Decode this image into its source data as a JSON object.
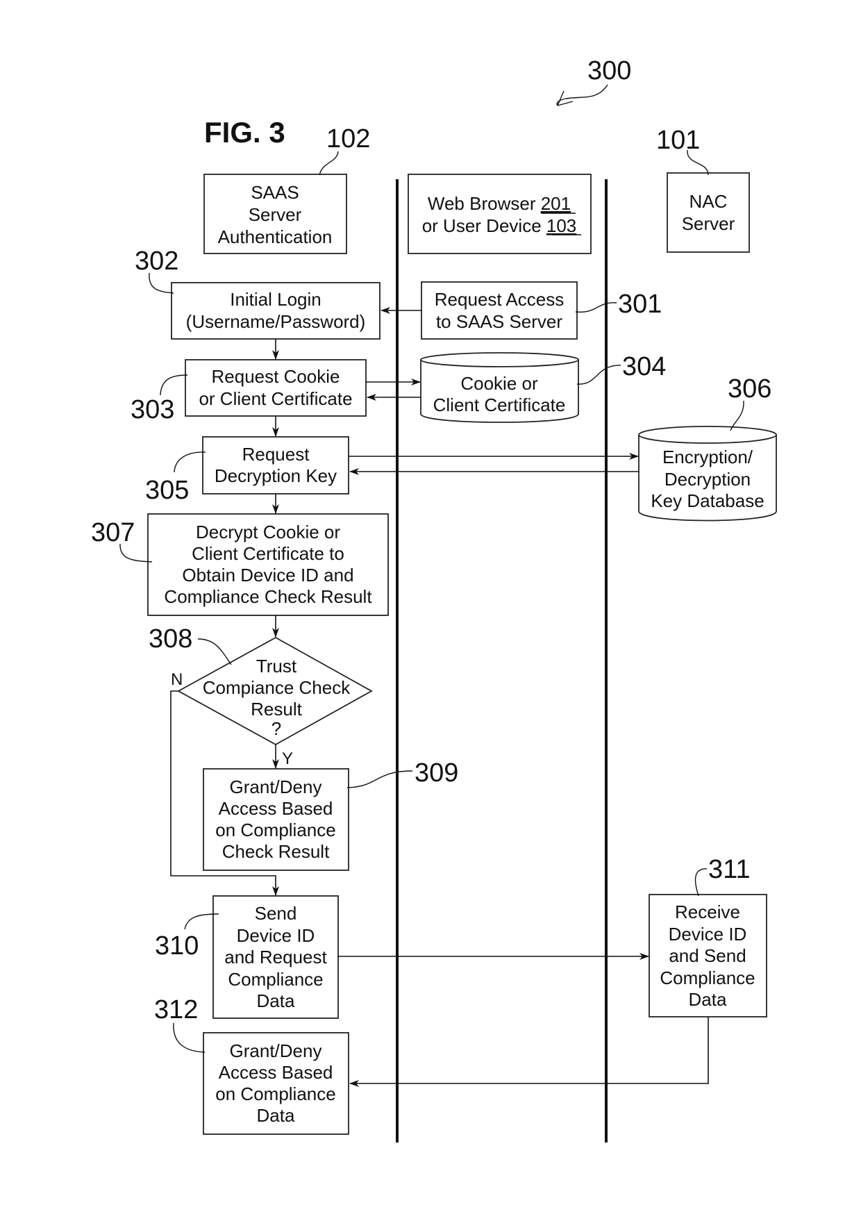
{
  "figure": {
    "title": "FIG. 3",
    "number": "300"
  },
  "actors": {
    "saas": {
      "ref": "102",
      "lines": [
        "SAAS",
        "Server",
        "Authentication"
      ]
    },
    "browser": {
      "lines": [
        "Web Browser ",
        "or User Device "
      ],
      "refs": [
        "201",
        "103"
      ]
    },
    "nac": {
      "ref": "101",
      "lines": [
        "NAC",
        "Server"
      ]
    }
  },
  "steps": {
    "s301": {
      "ref": "301",
      "lines": [
        "Request Access",
        "to SAAS Server"
      ]
    },
    "s302": {
      "ref": "302",
      "lines": [
        "Initial Login",
        "(Username/Password)"
      ]
    },
    "s303": {
      "ref": "303",
      "lines": [
        "Request Cookie",
        "or Client Certificate"
      ]
    },
    "s304": {
      "ref": "304",
      "lines": [
        "Cookie or",
        "Client Certificate"
      ]
    },
    "s305": {
      "ref": "305",
      "lines": [
        "Request",
        "Decryption Key"
      ]
    },
    "s306": {
      "ref": "306",
      "lines": [
        "Encryption/",
        "Decryption",
        "Key Database"
      ]
    },
    "s307": {
      "ref": "307",
      "lines": [
        "Decrypt Cookie or",
        "Client Certificate to",
        "Obtain Device ID and",
        "Compliance Check Result"
      ]
    },
    "s308": {
      "ref": "308",
      "lines": [
        "Trust",
        "Compiance Check",
        "Result",
        "?"
      ],
      "no_label": "N",
      "yes_label": "Y"
    },
    "s309": {
      "ref": "309",
      "lines": [
        "Grant/Deny",
        "Access Based",
        "on Compliance",
        "Check Result"
      ]
    },
    "s310": {
      "ref": "310",
      "lines": [
        "Send",
        "Device ID",
        "and Request",
        "Compliance",
        "Data"
      ]
    },
    "s311": {
      "ref": "311",
      "lines": [
        "Receive",
        "Device ID",
        "and Send",
        "Compliance",
        "Data"
      ]
    },
    "s312": {
      "ref": "312",
      "lines": [
        "Grant/Deny",
        "Access Based",
        "on Compliance",
        "Data"
      ]
    }
  }
}
